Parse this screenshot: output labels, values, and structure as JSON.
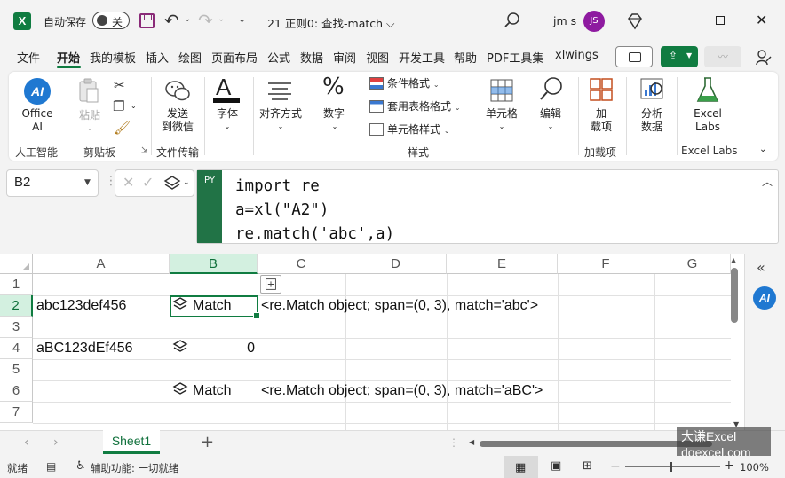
{
  "title_bar": {
    "autosave_label": "自动保存",
    "autosave_state": "关",
    "doc_title": "21 正则0: 查找-match",
    "title_caret": "⌵",
    "user_name": "jm s",
    "user_initials": "JS"
  },
  "menu_tabs": [
    "文件",
    "开始",
    "我的模板",
    "插入",
    "绘图",
    "页面布局",
    "公式",
    "数据",
    "审阅",
    "视图",
    "开发工具",
    "帮助",
    "PDF工具集",
    "xlwings"
  ],
  "active_tab": "开始",
  "ribbon": {
    "office_ai": "Office\nAI",
    "paste": "粘贴",
    "send_wechat": "发送\n到微信",
    "font": "字体",
    "align": "对齐方式",
    "number": "数字",
    "cond_format": "条件格式",
    "table_format": "套用表格格式",
    "cell_style": "单元格样式",
    "cells": "单元格",
    "edit": "编辑",
    "addins": "加\n载项",
    "analyze": "分析\n数据",
    "excel_labs": "Excel\nLabs",
    "groups": {
      "ai": "人工智能",
      "clipboard": "剪贴板",
      "file_transfer": "文件传输",
      "styles": "样式",
      "addins": "加载项",
      "labs": "Excel Labs"
    }
  },
  "formula_bar": {
    "name_box": "B2",
    "py_label": "PY",
    "code": "import re\na=xl(\"A2\")\nre.match('abc',a)"
  },
  "grid": {
    "columns": [
      "A",
      "B",
      "C",
      "D",
      "E",
      "F",
      "G"
    ],
    "rows": [
      "1",
      "2",
      "3",
      "4",
      "5",
      "6",
      "7"
    ],
    "selected_cell": "B2",
    "cells": {
      "A2": "abc123def456",
      "B2": "Match",
      "C2": "<re.Match object; span=(0, 3), match='abc'>",
      "A4": "aBC123dEf456",
      "B4": "0",
      "B6": "Match",
      "C6": "<re.Match object; span=(0, 3), match='aBC'>"
    }
  },
  "sheets": [
    "Sheet1"
  ],
  "watermark": [
    "大谦Excel",
    "dqexcel.com"
  ],
  "status": {
    "ready": "就绪",
    "accessibility": "辅助功能: 一切就绪",
    "zoom": "100%"
  },
  "colors": {
    "excel_green": "#107c41",
    "avatar_purple": "#8e1aa0",
    "ai_blue": "#1f78d1"
  }
}
